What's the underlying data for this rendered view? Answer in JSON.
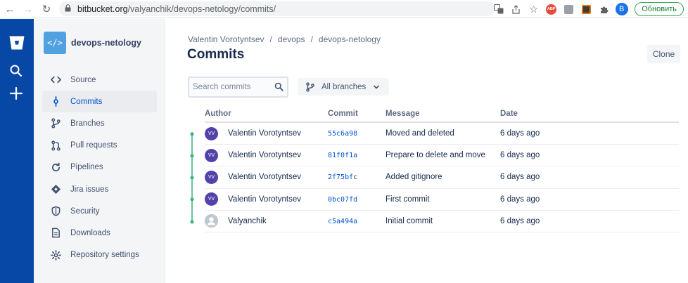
{
  "browser": {
    "url_host": "bitbucket.org",
    "url_path": "/valyanchik/devops-netology/commits/",
    "profile_letter": "B",
    "abp_label": "ABP",
    "update_label": "Обновить"
  },
  "repo": {
    "name": "devops-netology",
    "avatar_glyph": "</>"
  },
  "sidebar": {
    "items": [
      {
        "label": "Source",
        "icon": "code-icon"
      },
      {
        "label": "Commits",
        "icon": "commit-icon",
        "active": true
      },
      {
        "label": "Branches",
        "icon": "branch-icon"
      },
      {
        "label": "Pull requests",
        "icon": "pull-request-icon"
      },
      {
        "label": "Pipelines",
        "icon": "pipelines-icon"
      },
      {
        "label": "Jira issues",
        "icon": "jira-icon"
      },
      {
        "label": "Security",
        "icon": "shield-icon"
      },
      {
        "label": "Downloads",
        "icon": "document-icon"
      },
      {
        "label": "Repository settings",
        "icon": "gear-icon"
      }
    ]
  },
  "breadcrumb": {
    "owner": "Valentin Vorotyntsev",
    "sep": "/",
    "project": "devops",
    "repo": "devops-netology"
  },
  "page": {
    "title": "Commits",
    "clone_label": "Clone",
    "search_placeholder": "Search commits",
    "branch_label": "All branches"
  },
  "table": {
    "headers": {
      "author": "Author",
      "commit": "Commit",
      "message": "Message",
      "date": "Date"
    },
    "rows": [
      {
        "initials": "VV",
        "author": "Valentin Vorotyntsev",
        "hash": "55c6a98",
        "message": "Moved and deleted",
        "date": "6 days ago"
      },
      {
        "initials": "VV",
        "author": "Valentin Vorotyntsev",
        "hash": "81f0f1a",
        "message": "Prepare to delete and move",
        "date": "6 days ago"
      },
      {
        "initials": "VV",
        "author": "Valentin Vorotyntsev",
        "hash": "2f75bfc",
        "message": "Added gitignore",
        "date": "6 days ago"
      },
      {
        "initials": "VV",
        "author": "Valentin Vorotyntsev",
        "hash": "0bc07fd",
        "message": "First commit",
        "date": "6 days ago"
      },
      {
        "initials": "",
        "author": "Valyanchik",
        "hash": "c5a494a",
        "message": "Initial commit",
        "date": "6 days ago"
      }
    ]
  },
  "colors": {
    "global_nav": "#0747a6",
    "link": "#0052cc",
    "graph": "#36b37e",
    "avatar": "#5243aa"
  }
}
